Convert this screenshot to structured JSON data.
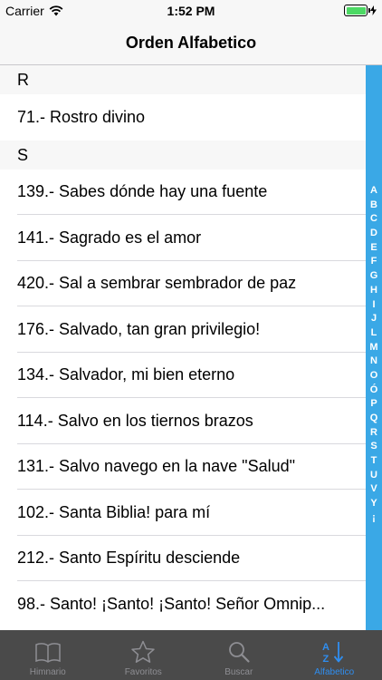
{
  "status_bar": {
    "carrier": "Carrier",
    "time": "1:52 PM"
  },
  "nav": {
    "title": "Orden Alfabetico"
  },
  "sections": [
    {
      "header": "R",
      "items": [
        "71.- Rostro divino"
      ]
    },
    {
      "header": "S",
      "items": [
        "139.- Sabes dónde hay una fuente",
        "141.- Sagrado es el amor",
        "420.- Sal a sembrar sembrador de paz",
        "176.- Salvado, tan gran privilegio!",
        "134.- Salvador, mi bien eterno",
        "114.- Salvo en los tiernos brazos",
        "131.- Salvo navego en la nave \"Salud\"",
        "102.- Santa Biblia! para mí",
        "212.- Santo Espíritu desciende",
        "98.- Santo! ¡Santo! ¡Santo! Señor Omnip..."
      ]
    }
  ],
  "index_letters": [
    "A",
    "B",
    "C",
    "D",
    "E",
    "F",
    "G",
    "H",
    "I",
    "J",
    "L",
    "M",
    "N",
    "O",
    "Ó",
    "P",
    "Q",
    "R",
    "S",
    "T",
    "U",
    "V",
    "Y",
    "¡"
  ],
  "tabs": [
    {
      "label": "Himnario",
      "icon": "book-icon",
      "active": false
    },
    {
      "label": "Favoritos",
      "icon": "star-icon",
      "active": false
    },
    {
      "label": "Buscar",
      "icon": "search-icon",
      "active": false
    },
    {
      "label": "Alfabetico",
      "icon": "alphabetical-sort-icon",
      "active": true
    }
  ],
  "colors": {
    "accent": "#2f8ef0",
    "index_bar": "#3aa8e6",
    "tab_bar": "#4a4a4a",
    "battery": "#4cd964"
  }
}
